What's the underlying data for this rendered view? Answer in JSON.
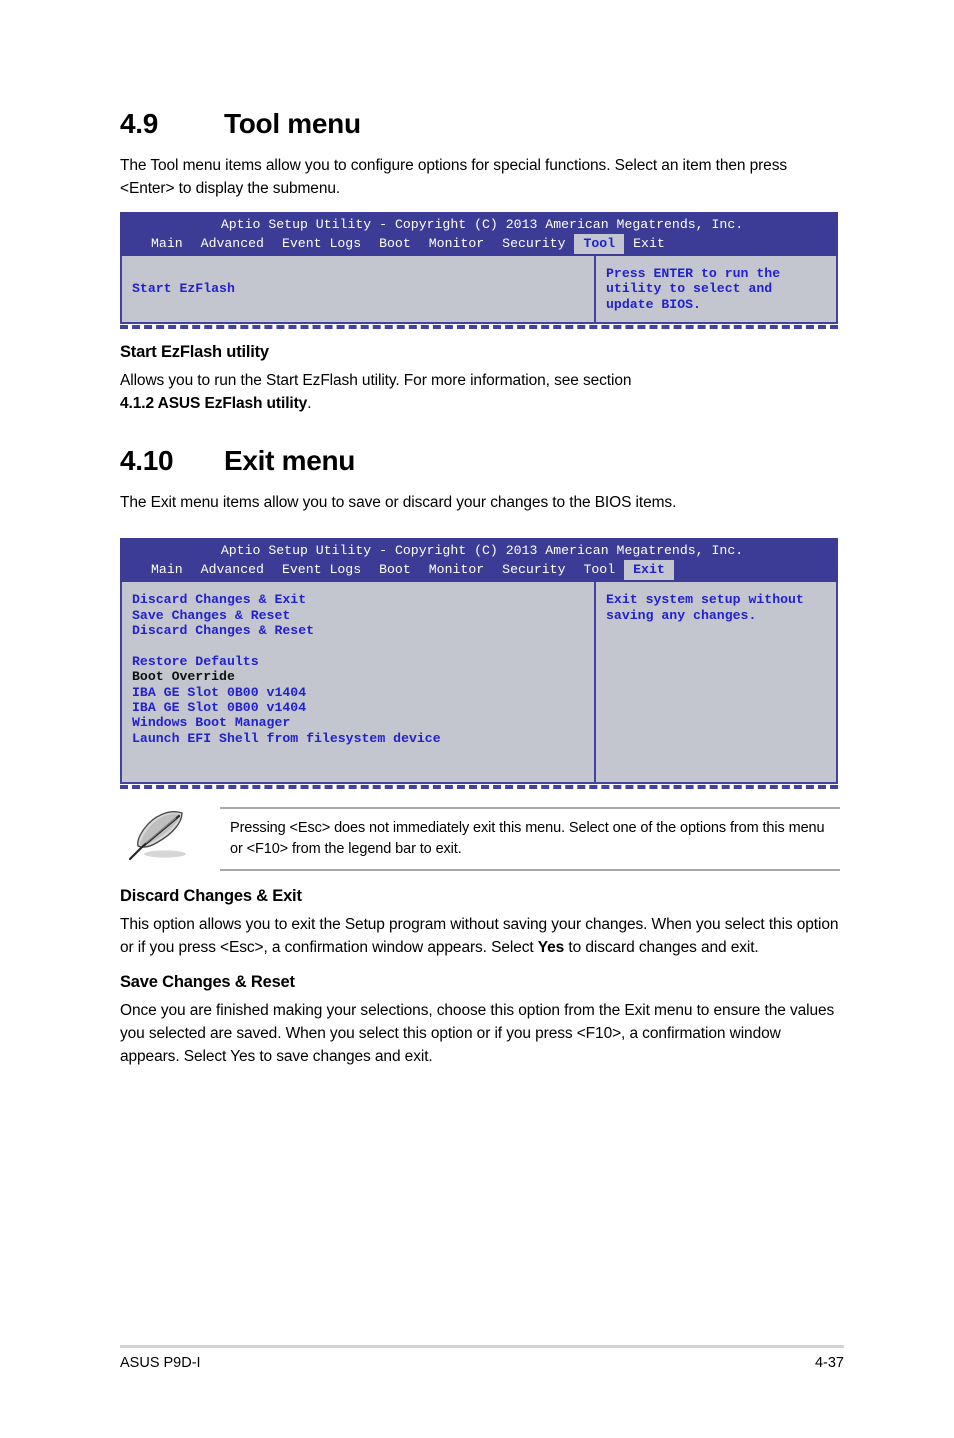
{
  "sections": [
    {
      "number": "4.9",
      "title": "Tool menu",
      "intro": "The Tool menu items allow you to configure options for special functions. Select an item then press <Enter> to display the submenu."
    },
    {
      "number": "4.10",
      "title": "Exit menu",
      "intro": "The Exit menu items allow you to save or discard your changes to the BIOS items."
    }
  ],
  "bios_tool": {
    "title": "Aptio Setup Utility - Copyright (C) 2013 American Megatrends, Inc.",
    "tabs": [
      {
        "label": "Main",
        "active": false
      },
      {
        "label": "Advanced",
        "active": false
      },
      {
        "label": "Event Logs",
        "active": false
      },
      {
        "label": "Boot",
        "active": false
      },
      {
        "label": "Monitor",
        "active": false
      },
      {
        "label": "Security",
        "active": false
      },
      {
        "label": "Tool",
        "active": true
      },
      {
        "label": "Exit",
        "active": false
      }
    ],
    "items": [
      "Start EzFlash"
    ],
    "help": "Press ENTER to run the\nutility to select and\nupdate BIOS."
  },
  "bios_exit": {
    "title": "Aptio Setup Utility - Copyright (C) 2013 American Megatrends, Inc.",
    "tabs": [
      {
        "label": "Main",
        "active": false
      },
      {
        "label": "Advanced",
        "active": false
      },
      {
        "label": "Event Logs",
        "active": false
      },
      {
        "label": "Boot",
        "active": false
      },
      {
        "label": "Monitor",
        "active": false
      },
      {
        "label": "Security",
        "active": false
      },
      {
        "label": "Tool",
        "active": false
      },
      {
        "label": "Exit",
        "active": true
      }
    ],
    "items_text": "Discard Changes & Exit\nSave Changes & Reset\nDiscard Changes & Reset\n\nRestore Defaults\n",
    "boot_override_label": "Boot Override",
    "boot_override_text": "IBA GE Slot 0B00 v1404\nIBA GE Slot 0B00 v1404\nWindows Boot Manager\n",
    "launch_shell": "Launch EFI Shell from filesystem device",
    "help": "Exit system setup without\nsaving any changes."
  },
  "ezflash": {
    "heading": "Start EzFlash utility",
    "line1": "Allows you to run the Start EzFlash utility. For more information, see section",
    "line2_bold": "4.1.2 ASUS EzFlash utility",
    "line2_tail": "."
  },
  "note": {
    "text": "Pressing <Esc> does not immediately exit this menu. Select one of the options from this menu or <F10> from the legend bar to exit.",
    "icon": "quill-pen-icon"
  },
  "discard": {
    "heading": "Discard Changes & Exit",
    "part1": "This option allows you to exit the Setup program without saving your changes. When you select this option or if you press <Esc>, a confirmation window appears. Select ",
    "bold": "Yes",
    "part2": " to discard changes and exit."
  },
  "save": {
    "heading": "Save Changes & Reset",
    "text": "Once you are finished making your selections, choose this option from the Exit menu to ensure the values you selected are saved. When you select this option or if you press <F10>, a confirmation window appears. Select Yes to save changes and exit."
  },
  "footer": {
    "left": "ASUS P9D-I",
    "right": "4-37"
  },
  "colors": {
    "bios_header_bg": "#3c3c96",
    "bios_body_bg": "#c3c6ce",
    "bios_border": "#4242a0",
    "bios_text": "#2222cc",
    "tab_active_bg": "#c3c6ce",
    "rule": "#d2d2d2"
  }
}
